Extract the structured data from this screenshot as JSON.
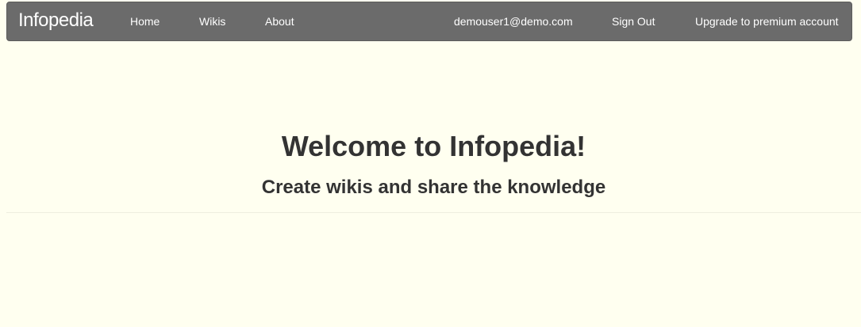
{
  "navbar": {
    "brand": "Infopedia",
    "links": {
      "home": "Home",
      "wikis": "Wikis",
      "about": "About"
    },
    "user_email": "demouser1@demo.com",
    "sign_out": "Sign Out",
    "upgrade": "Upgrade to premium account"
  },
  "hero": {
    "title": "Welcome to Infopedia!",
    "subtitle": "Create wikis and share the knowledge"
  },
  "colors": {
    "page_background": "#fffff0",
    "navbar_background": "#6b6b6b",
    "navbar_text": "#ffffff",
    "heading_text": "#333333"
  }
}
